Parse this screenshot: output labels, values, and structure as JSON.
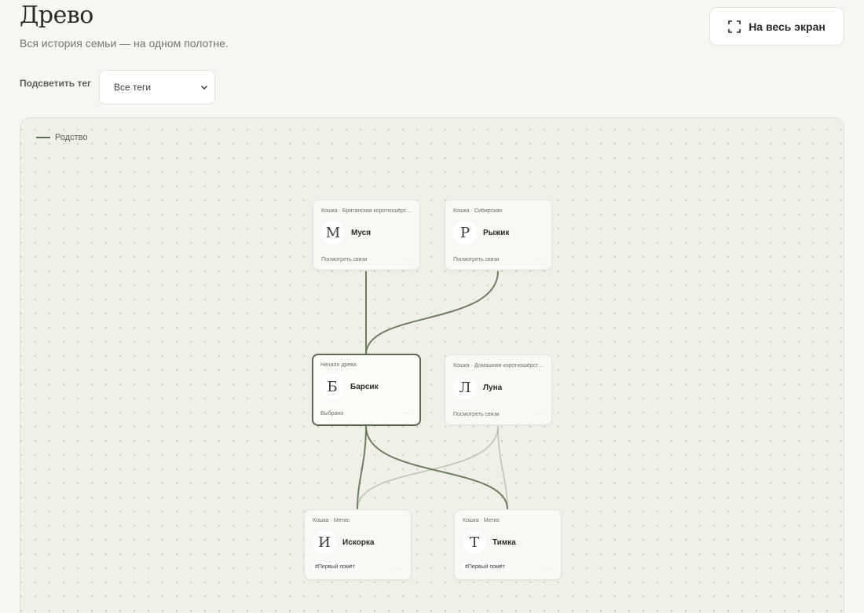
{
  "header": {
    "title": "Древо",
    "subtitle": "Вся история семьи — на одном полотне.",
    "fullscreen_label": "На весь экран",
    "fullscreen_icon": "expand-icon"
  },
  "filter": {
    "label": "Подсветить тег",
    "selected": "Все теги",
    "dropdown_icon": "chevron-down-icon"
  },
  "legend": {
    "kinship_label": "Родство"
  },
  "colors": {
    "accent": "#5d6a51",
    "edge_primary": "#6f7d60",
    "edge_muted": "#bfc2b4",
    "background": "#f7f6f1",
    "canvas": "#f0f0e8"
  },
  "nodes": {
    "musya": {
      "meta": "Кошка · Британская короткошёрстная",
      "initial": "М",
      "name": "Муся",
      "footer": "Посмотреть связи",
      "more": "···"
    },
    "ryzhik": {
      "meta": "Кошка · Сибирская",
      "initial": "Р",
      "name": "Рыжик",
      "footer": "Посмотреть связи",
      "more": "···"
    },
    "barsik": {
      "meta": "Начало древа",
      "initial": "Б",
      "name": "Барсик",
      "footer": "Выбрано",
      "more": "···"
    },
    "luna": {
      "meta": "Кошка · Домашняя короткошёрстная",
      "initial": "Л",
      "name": "Луна",
      "footer": "Посмотреть связи",
      "more": "···"
    },
    "iskorka": {
      "meta": "Кошка · Метис",
      "initial": "И",
      "name": "Искорка",
      "tag": "#Первый помёт",
      "more": "···"
    },
    "timka": {
      "meta": "Кошка · Метис",
      "initial": "Т",
      "name": "Тимка",
      "tag": "#Первый помёт",
      "more": "···"
    }
  }
}
